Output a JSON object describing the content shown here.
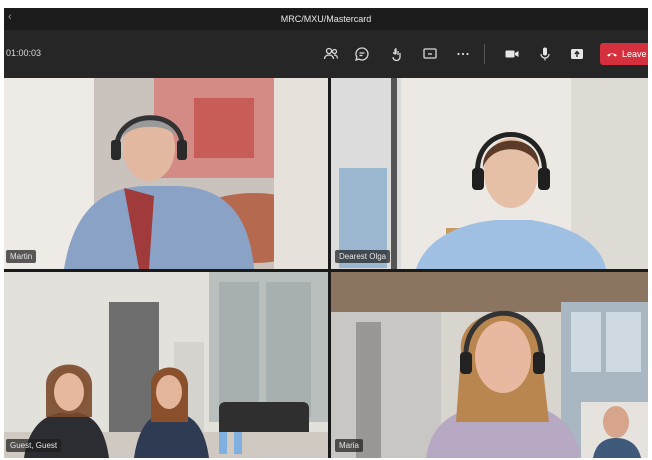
{
  "window": {
    "title": "MRC/MXU/Mastercard"
  },
  "toolbar": {
    "timer": "01:00:03",
    "leave_label": "Leave",
    "icons": [
      "people-icon",
      "chat-icon",
      "reactions-icon",
      "share-screen-icon",
      "more-options-icon",
      "camera-icon",
      "microphone-icon",
      "share-tray-icon"
    ]
  },
  "participants": [
    {
      "name": "Martin"
    },
    {
      "name": "Dearest Olga"
    },
    {
      "name": "Guest, Guest"
    },
    {
      "name": "Maria"
    }
  ],
  "colors": {
    "leave": "#d6303e",
    "toolbar": "#262626",
    "titlebar": "#1b1b1b"
  }
}
